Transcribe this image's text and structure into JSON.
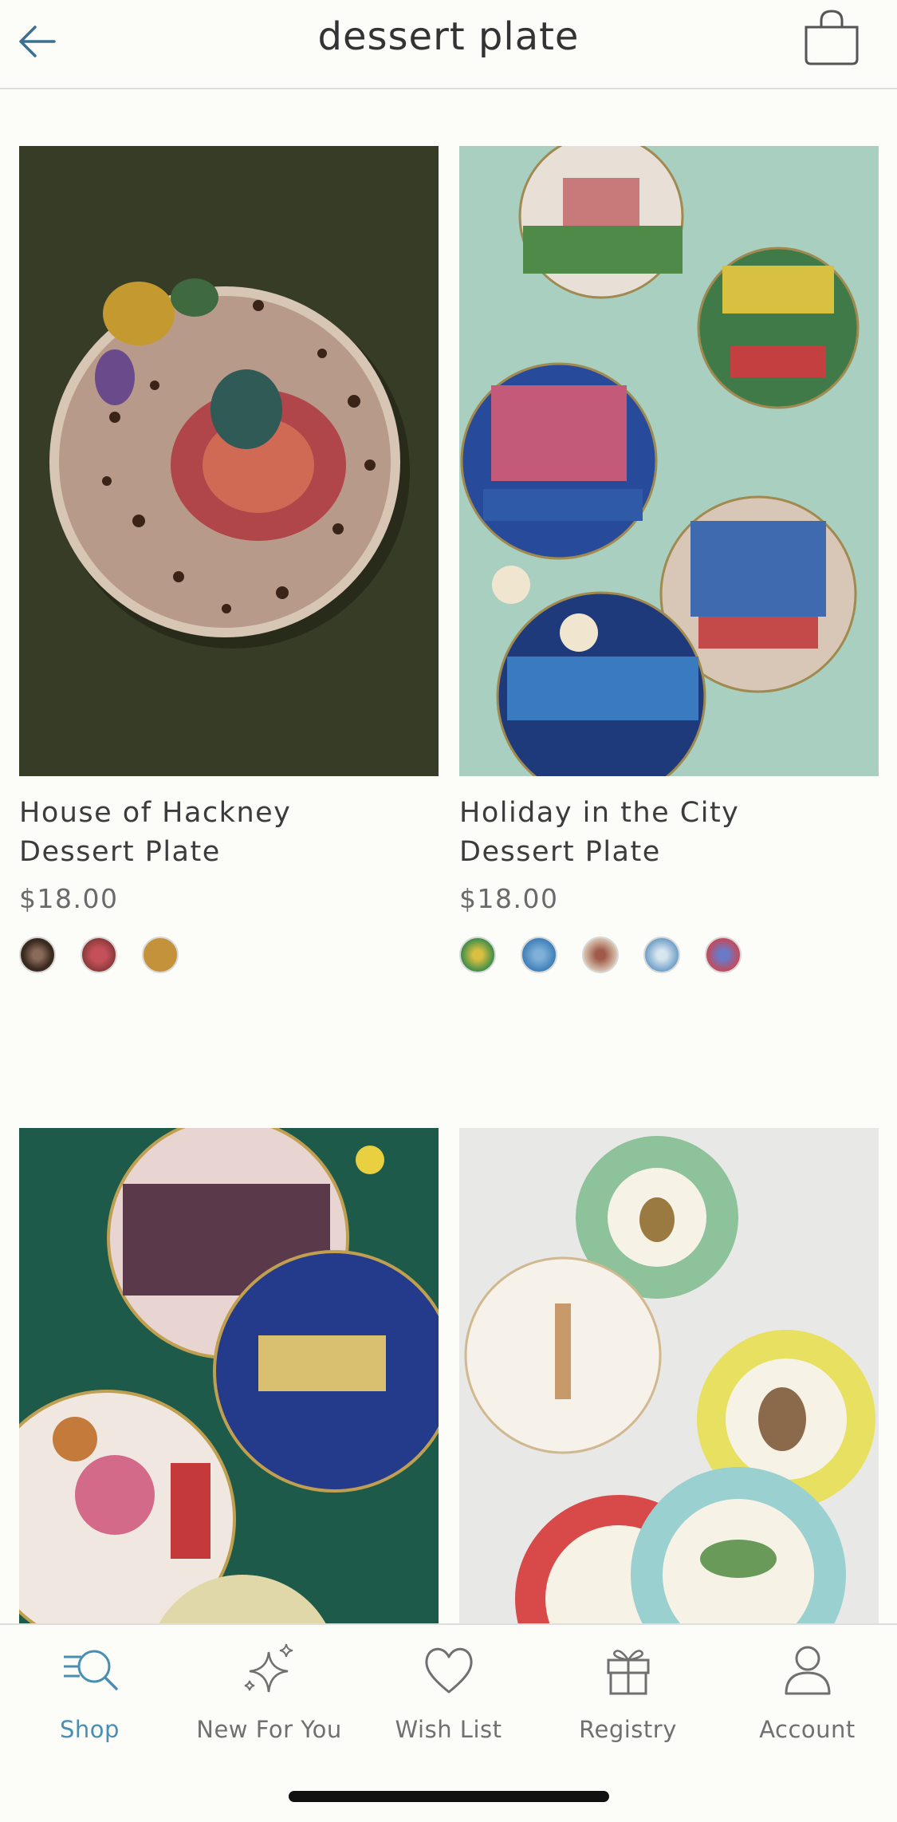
{
  "header": {
    "title": "dessert plate",
    "back_icon": "arrow-left-icon",
    "bag_icon": "shopping-bag-icon"
  },
  "products": [
    {
      "name_line1": "House of Hackney",
      "name_line2": "Dessert Plate",
      "price": "$18.00",
      "swatch_colors": [
        "#5a4033",
        "#9a4a45",
        "#c4923a"
      ]
    },
    {
      "name_line1": "Holiday in the City",
      "name_line2": "Dessert Plate",
      "price": "$18.00",
      "swatch_colors": [
        "#3f8d4a",
        "#3f7fb8",
        "#d8c4b0",
        "#6fa0c8",
        "#c44a5a"
      ]
    },
    {
      "name_line1": "",
      "name_line2": "",
      "price": "",
      "swatch_colors": []
    },
    {
      "name_line1": "",
      "name_line2": "",
      "price": "",
      "swatch_colors": []
    }
  ],
  "tabs": [
    {
      "label": "Shop",
      "icon": "shop-search-icon",
      "active": true
    },
    {
      "label": "New For You",
      "icon": "sparkle-icon",
      "active": false
    },
    {
      "label": "Wish List",
      "icon": "heart-icon",
      "active": false
    },
    {
      "label": "Registry",
      "icon": "gift-icon",
      "active": false
    },
    {
      "label": "Account",
      "icon": "person-icon",
      "active": false
    }
  ],
  "colors": {
    "accent": "#4a8fb3",
    "tab_inactive": "#707070",
    "background": "#fcfcf9"
  }
}
